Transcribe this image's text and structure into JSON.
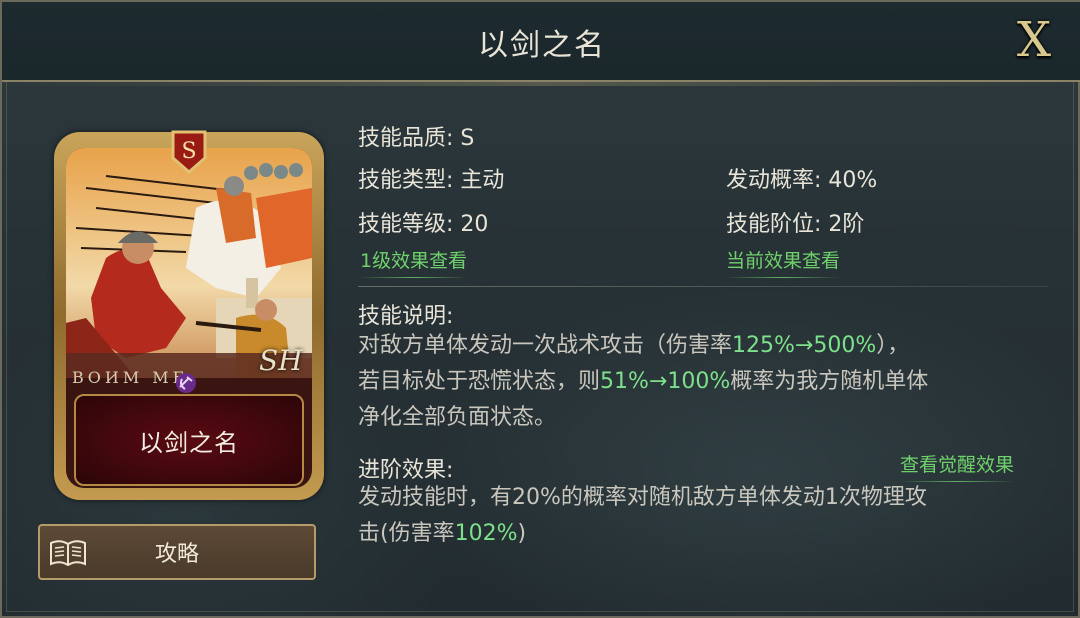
{
  "window": {
    "title": "以剑之名",
    "close_label": "X"
  },
  "card": {
    "name": "以剑之名",
    "rank_badge": "S",
    "code_text": "ВОИМ МЕ",
    "mark_text": "SH"
  },
  "guide_button": {
    "label": "攻略"
  },
  "skill": {
    "quality_label": "技能品质:",
    "quality_value": "S",
    "type_label": "技能类型:",
    "type_value": "主动",
    "trigger_label": "发动概率:",
    "trigger_value": "40%",
    "level_label": "技能等级:",
    "level_value": "20",
    "tier_label": "技能阶位:",
    "tier_value": "2阶",
    "link_level1": "1级效果查看",
    "link_current": "当前效果查看"
  },
  "description": {
    "title": "技能说明:",
    "line1_a": "对敌方单体发动一次战术攻击（伤害率",
    "line1_hl": "125%→500%",
    "line1_b": "），",
    "line2_a": "若目标处于恐慌状态，则",
    "line2_hl": "51%→100%",
    "line2_b": "概率为我方随机单体",
    "line3": "净化全部负面状态。"
  },
  "advance": {
    "title": "进阶效果:",
    "awaken_link": "查看觉醒效果",
    "line1": "发动技能时，有20%的概率对随机敌方单体发动1次物理攻",
    "line2_a": "击(伤害率",
    "line2_hl": "102%",
    "line2_b": ")"
  },
  "colors": {
    "highlight": "#7de08a",
    "link": "#6fd16c",
    "gold": "#d8c88e"
  }
}
